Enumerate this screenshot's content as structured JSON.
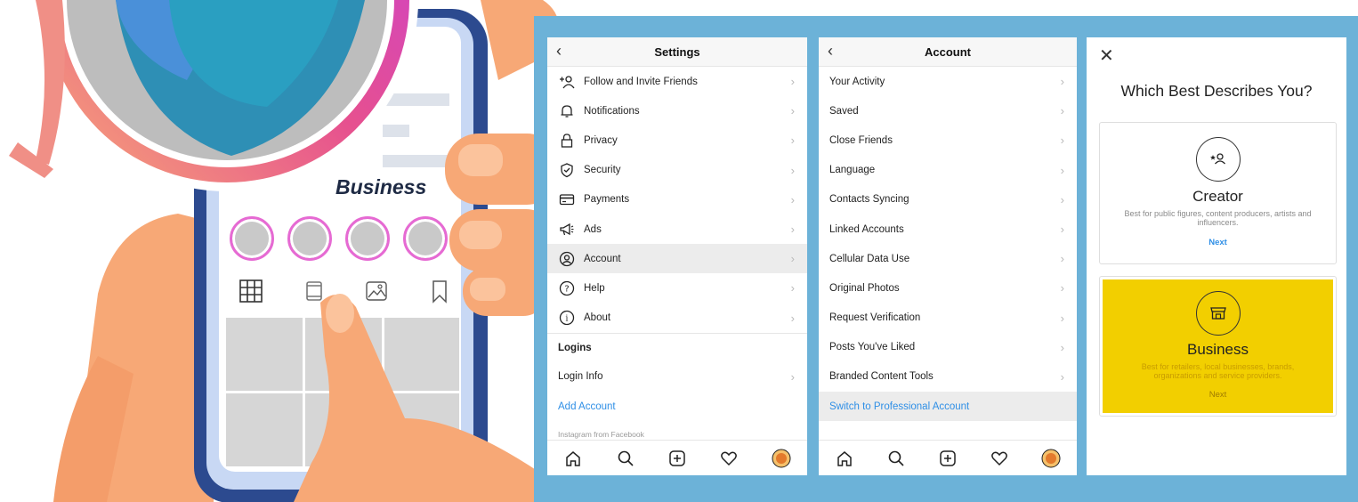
{
  "illustration": {
    "business_label": "Business"
  },
  "settings_screen": {
    "title": "Settings",
    "items": [
      {
        "label": "Follow and Invite Friends",
        "icon": "add-person-icon"
      },
      {
        "label": "Notifications",
        "icon": "bell-icon"
      },
      {
        "label": "Privacy",
        "icon": "lock-icon"
      },
      {
        "label": "Security",
        "icon": "shield-icon"
      },
      {
        "label": "Payments",
        "icon": "card-icon"
      },
      {
        "label": "Ads",
        "icon": "megaphone-icon"
      },
      {
        "label": "Account",
        "icon": "account-circle-icon"
      },
      {
        "label": "Help",
        "icon": "help-icon"
      },
      {
        "label": "About",
        "icon": "info-icon"
      }
    ],
    "logins_header": "Logins",
    "login_info": "Login Info",
    "add_account": "Add Account",
    "footer": "Instagram from Facebook"
  },
  "account_screen": {
    "title": "Account",
    "items": [
      "Your Activity",
      "Saved",
      "Close Friends",
      "Language",
      "Contacts Syncing",
      "Linked Accounts",
      "Cellular Data Use",
      "Original Photos",
      "Request Verification",
      "Posts You've Liked",
      "Branded Content Tools"
    ],
    "switch_link": "Switch to Professional Account"
  },
  "describe_screen": {
    "title": "Which Best Describes You?",
    "creator": {
      "name": "Creator",
      "desc": "Best for public figures, content producers, artists and influencers.",
      "next": "Next"
    },
    "business": {
      "name": "Business",
      "desc": "Best for retailers, local businesses, brands, organizations and service providers.",
      "next": "Next"
    }
  },
  "colors": {
    "panel_blue": "#6cb2d8",
    "link_blue": "#2f8fe6",
    "business_yellow": "#f2cf00",
    "hand_skin": "#f7a876"
  }
}
